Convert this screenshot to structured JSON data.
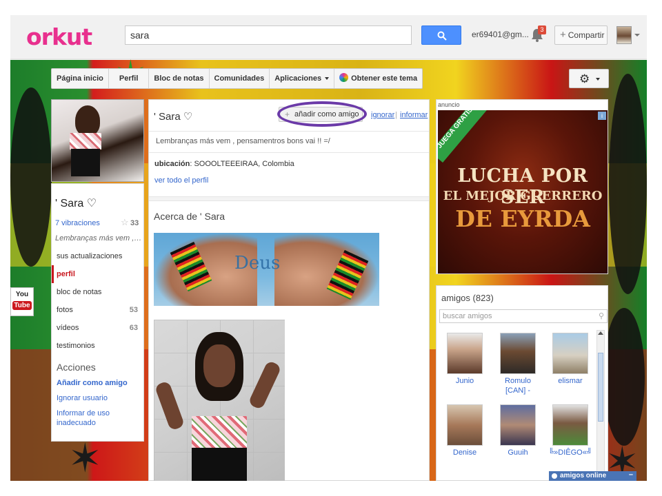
{
  "topbar": {
    "logo": "orkut",
    "search_value": "sara",
    "email": "er69401@gm...",
    "notifications_count": "3",
    "share_label": "Compartir"
  },
  "nav": {
    "items": [
      "Página inicio",
      "Perfil",
      "Bloc de notas",
      "Comunidades",
      "Aplicaciones",
      "Obtener este tema"
    ]
  },
  "profile": {
    "name": "' Sara ♡",
    "vibrations": "7 vibraciones",
    "stars": "33",
    "motto_short": "Lembranças más vem , p...",
    "menu": [
      {
        "label": "sus actualizaciones",
        "count": ""
      },
      {
        "label": "perfil",
        "count": ""
      },
      {
        "label": "bloc de notas",
        "count": ""
      },
      {
        "label": "fotos",
        "count": "53"
      },
      {
        "label": "vídeos",
        "count": "63"
      },
      {
        "label": "testimonios",
        "count": ""
      }
    ],
    "actions_title": "Acciones",
    "actions": [
      "Añadir como amigo",
      "Ignorar usuario",
      "Informar de uso inadecuado"
    ]
  },
  "youtube": {
    "line1": "You",
    "line2": "Tube"
  },
  "main": {
    "name": "' Sara ♡",
    "add_friend": "añadir como amigo",
    "ignore": "ignorar",
    "separator": "|",
    "report": "informar",
    "status": "Lembranças más vem , pensamentros bons vai !! =/",
    "location_label": "ubicación",
    "location_value": ": SOOOLTEEEIRAA, Colombia",
    "full_profile": "ver todo el perfil",
    "about_title": "Acerca de ' Sara",
    "photo_text": "Deus"
  },
  "ad": {
    "label": "anuncio",
    "info": "i",
    "ribbon": "JUEGA GRATIS",
    "line1": "LUCHA POR SER",
    "line2": "EL MEJOR GUERRERO",
    "line3": "DE EYRDA"
  },
  "friends": {
    "title": "amigos (823)",
    "search_placeholder": "buscar amigos",
    "list": [
      {
        "name": "Junio"
      },
      {
        "name": "Romulo [CAN] -"
      },
      {
        "name": "elismar"
      },
      {
        "name": "Denise"
      },
      {
        "name": "Guuih"
      },
      {
        "name": "╚»DIÊGO«╝"
      }
    ]
  },
  "chat": {
    "label": "amigos online",
    "minimize": "–"
  },
  "colors": {
    "brand": "#e8308e",
    "link": "#3366cc",
    "search_button": "#4d90fe",
    "highlight_oval": "#6b3aa8"
  },
  "icons": [
    "search-icon",
    "bell-icon",
    "gear-icon",
    "star-icon",
    "theme-icon"
  ]
}
